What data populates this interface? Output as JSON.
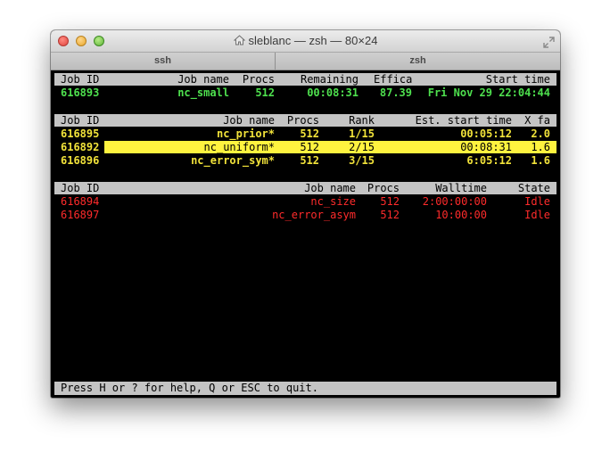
{
  "window": {
    "title": "sleblanc — zsh — 80×24",
    "tabs": [
      "ssh",
      "zsh"
    ]
  },
  "section1": {
    "headers": [
      "Job ID",
      "Job name",
      "Procs",
      "Remaining",
      "Effica",
      "Start time"
    ],
    "rows": [
      [
        "616893",
        "nc_small",
        "512",
        "00:08:31",
        "87.39",
        "Fri Nov 29 22:04:44"
      ]
    ]
  },
  "section2": {
    "headers": [
      "Job ID",
      "Job name",
      "Procs",
      "Rank",
      "Est. start time",
      "X fa"
    ],
    "rows": [
      [
        "616895",
        "nc_prior*",
        "512",
        "1/15",
        "00:05:12",
        "2.0"
      ],
      [
        "616892",
        "nc_uniform*",
        "512",
        "2/15",
        "00:08:31",
        "1.6"
      ],
      [
        "616896",
        "nc_error_sym*",
        "512",
        "3/15",
        "6:05:12",
        "1.6"
      ]
    ]
  },
  "section3": {
    "headers": [
      "Job ID",
      "Job name",
      "Procs",
      "Walltime",
      "State"
    ],
    "rows": [
      [
        "616894",
        "nc_size",
        "512",
        "2:00:00:00",
        "Idle"
      ],
      [
        "616897",
        "nc_error_asym",
        "512",
        "10:00:00",
        "Idle"
      ]
    ]
  },
  "status_bar": "Press H or ? for help, Q or ESC to quit.",
  "colors": {
    "running": "#4ee04e",
    "eligible": "#f2e33a",
    "blocked": "#ff2b2b",
    "selected_row": "#fff33f",
    "header_bg": "#c4c4c4"
  }
}
